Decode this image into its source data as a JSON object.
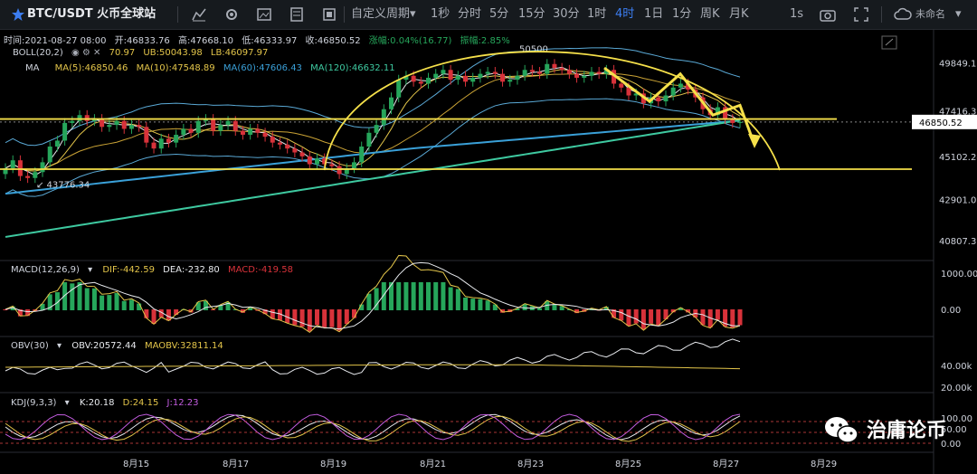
{
  "toolbar": {
    "symbol": "BTC/USDT 火币全球站",
    "custom_period": "自定义周期",
    "periods": [
      "1秒",
      "分时",
      "5分",
      "15分",
      "30分",
      "1时",
      "4时",
      "1日",
      "1分",
      "周K",
      "月K"
    ],
    "active_period": "4时",
    "right_interval": "1s",
    "theme_label": "未命名"
  },
  "info_bar": {
    "time": "时间:2021-08-27 08:00",
    "open": "开:46833.76",
    "high": "高:47668.10",
    "low": "低:46333.97",
    "close": "收:46850.52",
    "change": "涨幅:0.04%(16.77)",
    "amplitude": "振幅:2.85%"
  },
  "boll_row": {
    "name": "BOLL(20,2)",
    "mid": "70.97",
    "ub": "UB:50043.98",
    "lb": "LB:46097.97"
  },
  "ma_row": {
    "name": "MA",
    "ma5": "MA(5):46850.46",
    "ma10": "MA(10):47548.89",
    "ma60": "MA(60):47606.43",
    "ma120": "MA(120):46632.11"
  },
  "macd_row": {
    "name": "MACD(12,26,9)",
    "dif": "DIF:-442.59",
    "dea": "DEA:-232.80",
    "macd": "MACD:-419.58"
  },
  "obv_row": {
    "name": "OBV(30)",
    "obv": "OBV:20572.44",
    "maobv": "MAOBV:32811.14"
  },
  "kdj_row": {
    "name": "KDJ(9,3,3)",
    "k": "K:20.18",
    "d": "D:24.15",
    "j": "J:12.23"
  },
  "watermark": "治庸论币",
  "colors": {
    "up": "#26a65b",
    "down": "#d8323a",
    "boll": "#5aa9d6",
    "ma5": "#e8eaee",
    "ma10": "#e3c54a",
    "ma60": "#3aa0d8",
    "ma120": "#3ec9a0",
    "annot": "#f5e04a",
    "price_tag": "#ffffff"
  },
  "chart_data": {
    "type": "candlestick",
    "main_axis": {
      "ticks": [
        "49849.13",
        "47416.30",
        "45102.24",
        "42901.05",
        "40807.31"
      ],
      "last_price": "46850.52"
    },
    "x_ticks": [
      "8月15",
      "8月17",
      "8月19",
      "8月21",
      "8月23",
      "8月25",
      "8月27",
      "8月29"
    ],
    "labels": {
      "high": "50500",
      "low": "43776.34"
    },
    "macd_axis": [
      "1000.00",
      "0.00"
    ],
    "obv_axis": [
      "40.00k",
      "20.00k"
    ],
    "kdj_axis": [
      "100.00",
      "50.00",
      "0.00"
    ],
    "close": [
      44500,
      44900,
      44100,
      44000,
      44300,
      44800,
      45600,
      45900,
      46800,
      46900,
      47200,
      46900,
      47000,
      46600,
      46700,
      46900,
      46500,
      46700,
      46600,
      45800,
      45500,
      46000,
      45800,
      46200,
      46500,
      46300,
      46900,
      47000,
      46400,
      46700,
      46900,
      46400,
      46200,
      46500,
      46300,
      46100,
      45800,
      45700,
      45500,
      45300,
      45100,
      44700,
      45000,
      44700,
      44600,
      44200,
      44500,
      44800,
      45600,
      46300,
      46700,
      47500,
      48100,
      49000,
      49200,
      48900,
      48800,
      49100,
      49300,
      49500,
      49000,
      49200,
      48900,
      49100,
      49300,
      49400,
      49300,
      48900,
      49000,
      49200,
      49500,
      49400,
      49300,
      49800,
      49600,
      49500,
      49300,
      49100,
      49200,
      49400,
      49300,
      49500,
      48800,
      48600,
      48200,
      48300,
      47800,
      48100,
      47900,
      48200,
      48600,
      48800,
      48500,
      48100,
      47500,
      47200,
      47600,
      47000,
      46800,
      46850
    ],
    "annotations": {
      "horizontal_levels": [
        47000,
        44450
      ],
      "arc": "yellow arc from 8月20 low to right edge, peaking near 50500",
      "arrows": "zigzag yellow arrows 8月24 to 8月27 pointing down"
    }
  }
}
